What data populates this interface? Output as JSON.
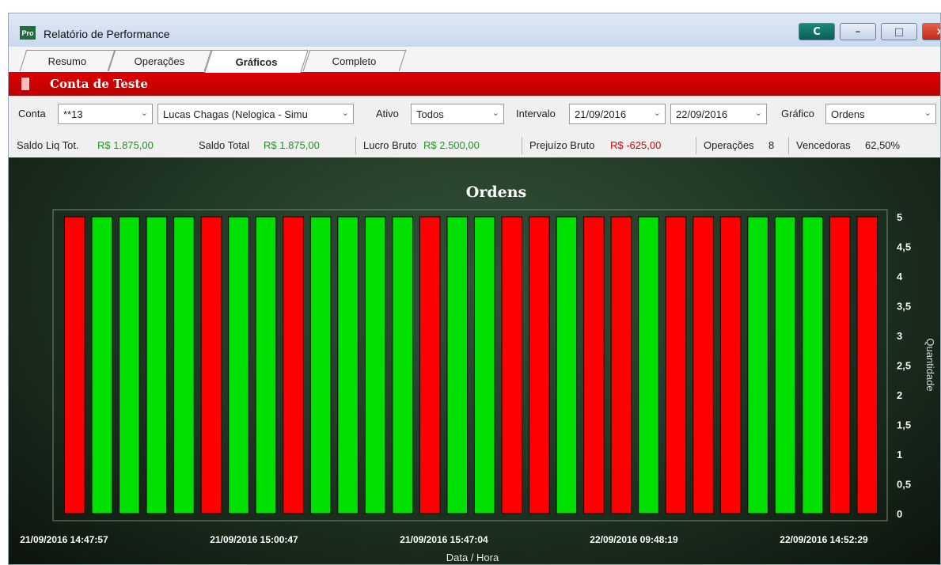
{
  "window": {
    "title": "Relatório de Performance",
    "app_icon_text": "Pro",
    "buttons": {
      "c_label": "C",
      "min_label": "–",
      "max_label": "□",
      "close_label": "×"
    }
  },
  "tabs": [
    {
      "label": "Resumo",
      "active": false
    },
    {
      "label": "Operações",
      "active": false
    },
    {
      "label": "Gráficos",
      "active": true
    },
    {
      "label": "Completo",
      "active": false
    }
  ],
  "account": {
    "name": "Conta de Teste"
  },
  "filters": {
    "conta_label": "Conta",
    "conta_value": "**13",
    "user_value": "Lucas Chagas (Nelogica - Simu",
    "ativo_label": "Ativo",
    "ativo_value": "Todos",
    "intervalo_label": "Intervalo",
    "date_from": "21/09/2016",
    "date_to": "22/09/2016",
    "grafico_label": "Gráfico",
    "grafico_value": "Ordens"
  },
  "summary": {
    "saldo_liq_label": "Saldo Liq Tot.",
    "saldo_liq_value": "R$ 1.875,00",
    "saldo_total_label": "Saldo Total",
    "saldo_total_value": "R$ 1.875,00",
    "lucro_label": "Lucro Bruto",
    "lucro_value": "R$ 2.500,00",
    "prejuizo_label": "Prejuízo Bruto",
    "prejuizo_value": "R$ -625,00",
    "operacoes_label": "Operações",
    "operacoes_value": "8",
    "vencedoras_label": "Vencedoras",
    "vencedoras_value": "62,50%"
  },
  "colors": {
    "win": "#00e000",
    "loss": "#ff0000",
    "accent": "#d40000"
  },
  "chart_data": {
    "type": "bar",
    "title": "Ordens",
    "xlabel": "Data / Hora",
    "ylabel": "Quantidade",
    "ylim": [
      0,
      5
    ],
    "y_ticks": [
      "0",
      "0,5",
      "1",
      "1,5",
      "2",
      "2,5",
      "3",
      "3,5",
      "4",
      "4,5",
      "5"
    ],
    "x_tick_labels": [
      "21/09/2016 14:47:57",
      "21/09/2016 15:00:47",
      "21/09/2016 15:47:04",
      "22/09/2016 09:48:19",
      "22/09/2016 14:52:29"
    ],
    "grid": false,
    "legend": "none",
    "values": [
      5,
      5,
      5,
      5,
      5,
      5,
      5,
      5,
      5,
      5,
      5,
      5,
      5,
      5,
      5,
      5,
      5,
      5,
      5,
      5,
      5,
      5,
      5,
      5,
      5,
      5,
      5,
      5,
      5,
      5
    ],
    "bar_colors": [
      "loss",
      "win",
      "win",
      "win",
      "win",
      "loss",
      "win",
      "win",
      "loss",
      "win",
      "win",
      "win",
      "win",
      "loss",
      "win",
      "win",
      "loss",
      "loss",
      "win",
      "loss",
      "loss",
      "win",
      "loss",
      "loss",
      "loss",
      "win",
      "win",
      "win",
      "loss",
      "loss"
    ]
  }
}
